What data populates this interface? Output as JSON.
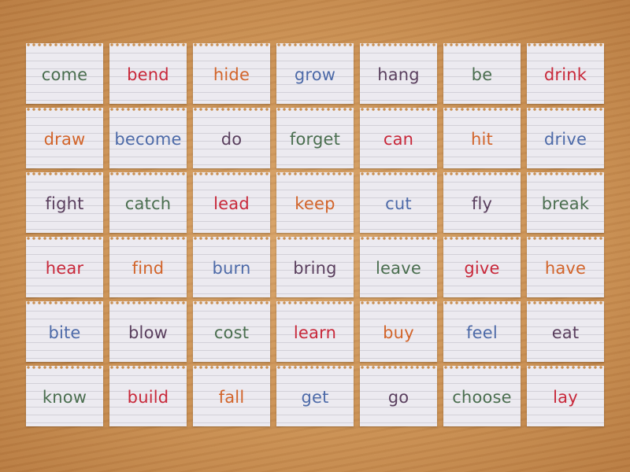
{
  "colors": {
    "green": "#4a6e4f",
    "red": "#c8283a",
    "orange": "#d2642a",
    "blue": "#4d6aa8",
    "purple": "#5a3f5e"
  },
  "cards": [
    {
      "word": "come",
      "color": "green"
    },
    {
      "word": "bend",
      "color": "red"
    },
    {
      "word": "hide",
      "color": "orange"
    },
    {
      "word": "grow",
      "color": "blue"
    },
    {
      "word": "hang",
      "color": "purple"
    },
    {
      "word": "be",
      "color": "green"
    },
    {
      "word": "drink",
      "color": "red"
    },
    {
      "word": "draw",
      "color": "orange"
    },
    {
      "word": "become",
      "color": "blue"
    },
    {
      "word": "do",
      "color": "purple"
    },
    {
      "word": "forget",
      "color": "green"
    },
    {
      "word": "can",
      "color": "red"
    },
    {
      "word": "hit",
      "color": "orange"
    },
    {
      "word": "drive",
      "color": "blue"
    },
    {
      "word": "fight",
      "color": "purple"
    },
    {
      "word": "catch",
      "color": "green"
    },
    {
      "word": "lead",
      "color": "red"
    },
    {
      "word": "keep",
      "color": "orange"
    },
    {
      "word": "cut",
      "color": "blue"
    },
    {
      "word": "fly",
      "color": "purple"
    },
    {
      "word": "break",
      "color": "green"
    },
    {
      "word": "hear",
      "color": "red"
    },
    {
      "word": "find",
      "color": "orange"
    },
    {
      "word": "burn",
      "color": "blue"
    },
    {
      "word": "bring",
      "color": "purple"
    },
    {
      "word": "leave",
      "color": "green"
    },
    {
      "word": "give",
      "color": "red"
    },
    {
      "word": "have",
      "color": "orange"
    },
    {
      "word": "bite",
      "color": "blue"
    },
    {
      "word": "blow",
      "color": "purple"
    },
    {
      "word": "cost",
      "color": "green"
    },
    {
      "word": "learn",
      "color": "red"
    },
    {
      "word": "buy",
      "color": "orange"
    },
    {
      "word": "feel",
      "color": "blue"
    },
    {
      "word": "eat",
      "color": "purple"
    },
    {
      "word": "know",
      "color": "green"
    },
    {
      "word": "build",
      "color": "red"
    },
    {
      "word": "fall",
      "color": "orange"
    },
    {
      "word": "get",
      "color": "blue"
    },
    {
      "word": "go",
      "color": "purple"
    },
    {
      "word": "choose",
      "color": "green"
    },
    {
      "word": "lay",
      "color": "red"
    }
  ]
}
